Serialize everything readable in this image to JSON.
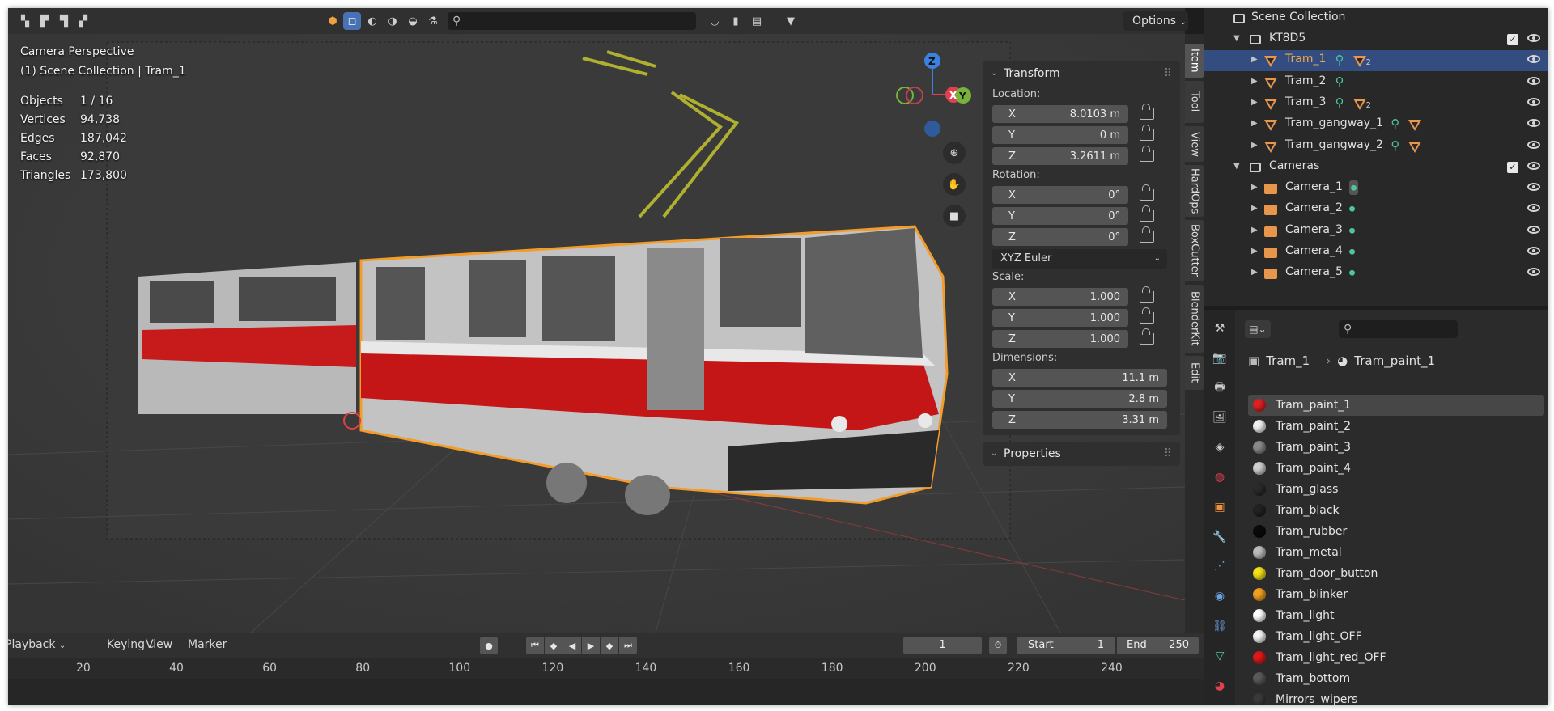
{
  "viewport": {
    "overlay_title": "Camera Perspective",
    "overlay_subtitle": "(1) Scene Collection | Tram_1",
    "stats": [
      {
        "label": "Objects",
        "value": "1 / 16"
      },
      {
        "label": "Vertices",
        "value": "94,738"
      },
      {
        "label": "Edges",
        "value": "187,042"
      },
      {
        "label": "Faces",
        "value": "92,870"
      },
      {
        "label": "Triangles",
        "value": "173,800"
      }
    ],
    "options_label": "Options",
    "gizmo": {
      "x": "X",
      "y": "Y",
      "z": "Z"
    }
  },
  "side_tabs": [
    "Item",
    "Tool",
    "View",
    "HardOps",
    "BoxCutter",
    "BlenderKit",
    "Edit"
  ],
  "transform": {
    "title": "Transform",
    "location_label": "Location:",
    "location": [
      {
        "axis": "X",
        "value": "8.0103 m"
      },
      {
        "axis": "Y",
        "value": "0 m"
      },
      {
        "axis": "Z",
        "value": "3.2611 m"
      }
    ],
    "rotation_label": "Rotation:",
    "rotation": [
      {
        "axis": "X",
        "value": "0°"
      },
      {
        "axis": "Y",
        "value": "0°"
      },
      {
        "axis": "Z",
        "value": "0°"
      }
    ],
    "rotation_mode": "XYZ Euler",
    "scale_label": "Scale:",
    "scale": [
      {
        "axis": "X",
        "value": "1.000"
      },
      {
        "axis": "Y",
        "value": "1.000"
      },
      {
        "axis": "Z",
        "value": "1.000"
      }
    ],
    "dimensions_label": "Dimensions:",
    "dimensions": [
      {
        "axis": "X",
        "value": "11.1 m"
      },
      {
        "axis": "Y",
        "value": "2.8 m"
      },
      {
        "axis": "Z",
        "value": "3.31 m"
      }
    ],
    "properties_title": "Properties"
  },
  "timeline": {
    "menus": [
      "Playback",
      "Keying",
      "View",
      "Marker"
    ],
    "current_frame": "1",
    "start_label": "Start",
    "start_value": "1",
    "end_label": "End",
    "end_value": "250",
    "ruler": [
      "20",
      "40",
      "60",
      "80",
      "100",
      "120",
      "140",
      "160",
      "180",
      "200",
      "220",
      "240"
    ]
  },
  "outliner": {
    "root": "Scene Collection",
    "rows": [
      {
        "label": "KT8D5",
        "kind": "collection"
      },
      {
        "label": "Tram_1",
        "kind": "mesh",
        "selected": true,
        "sub": "2"
      },
      {
        "label": "Tram_2",
        "kind": "mesh"
      },
      {
        "label": "Tram_3",
        "kind": "mesh",
        "sub": "2"
      },
      {
        "label": "Tram_gangway_1",
        "kind": "mesh"
      },
      {
        "label": "Tram_gangway_2",
        "kind": "mesh"
      },
      {
        "label": "Cameras",
        "kind": "collection"
      },
      {
        "label": "Camera_1",
        "kind": "camera"
      },
      {
        "label": "Camera_2",
        "kind": "camera"
      },
      {
        "label": "Camera_3",
        "kind": "camera"
      },
      {
        "label": "Camera_4",
        "kind": "camera"
      },
      {
        "label": "Camera_5",
        "kind": "camera"
      }
    ]
  },
  "properties": {
    "breadcrumb_object": "Tram_1",
    "breadcrumb_material": "Tram_paint_1",
    "materials": [
      {
        "name": "Tram_paint_1",
        "color": "#e02020"
      },
      {
        "name": "Tram_paint_2",
        "color": "#f2f2f2"
      },
      {
        "name": "Tram_paint_3",
        "color": "#8a8a8a"
      },
      {
        "name": "Tram_paint_4",
        "color": "#d0d0d0"
      },
      {
        "name": "Tram_glass",
        "color": "#2a2a2a"
      },
      {
        "name": "Tram_black",
        "color": "#222222"
      },
      {
        "name": "Tram_rubber",
        "color": "#0a0a0a"
      },
      {
        "name": "Tram_metal",
        "color": "#bdbdbd"
      },
      {
        "name": "Tram_door_button",
        "color": "#f5e11a"
      },
      {
        "name": "Tram_blinker",
        "color": "#f0a020"
      },
      {
        "name": "Tram_light",
        "color": "#ffffff"
      },
      {
        "name": "Tram_light_OFF",
        "color": "#f4f4f4"
      },
      {
        "name": "Tram_light_red_OFF",
        "color": "#e01818"
      },
      {
        "name": "Tram_bottom",
        "color": "#5a5a5a"
      },
      {
        "name": "Mirrors_wipers",
        "color": "#3a3a3a"
      }
    ]
  }
}
